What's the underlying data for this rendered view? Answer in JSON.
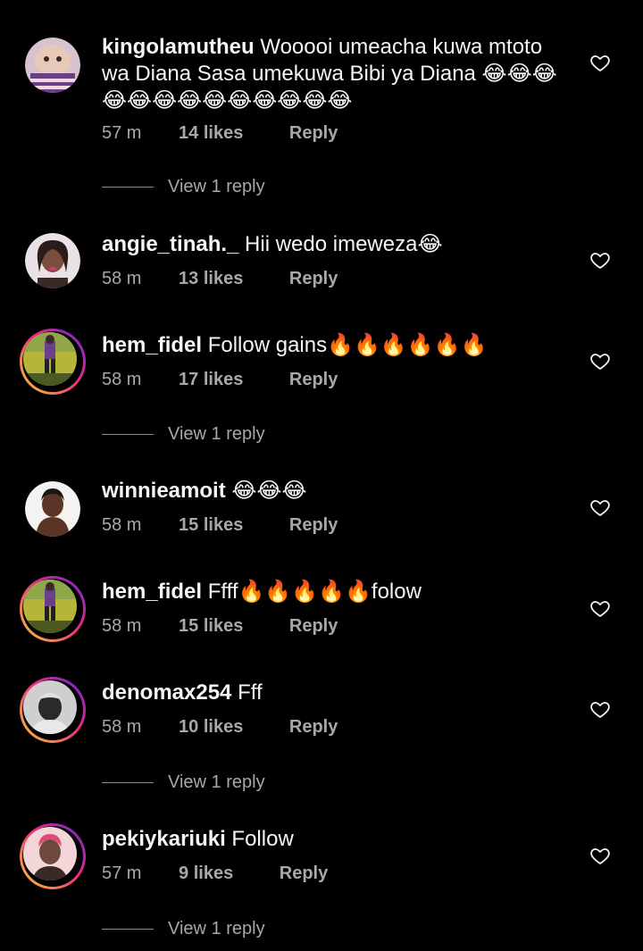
{
  "comments": [
    {
      "username": "kingolamutheu",
      "text": "Wooooi umeacha kuwa mtoto wa Diana Sasa umekuwa Bibi ya Diana 😂😂😂😂😂😂😂😂😂😂😂😂😂",
      "time": "57 m",
      "likes": "14 likes",
      "reply": "Reply",
      "view_replies": "View 1 reply",
      "story_ring": false,
      "avatar_colors": [
        "#c9a6b8",
        "#6b3f8a",
        "#f0d9e0"
      ]
    },
    {
      "username": "angie_tinah._",
      "text": "Hii wedo imeweza😂",
      "time": "58 m",
      "likes": "13 likes",
      "reply": "Reply",
      "view_replies": "",
      "story_ring": false,
      "avatar_colors": [
        "#e8e2e6",
        "#3a2a26",
        "#d63b70"
      ]
    },
    {
      "username": "hem_fidel",
      "text": "Follow gains🔥🔥🔥🔥🔥🔥",
      "time": "58 m",
      "likes": "17 likes",
      "reply": "Reply",
      "view_replies": "View 1 reply",
      "story_ring": true,
      "avatar_colors": [
        "#b7b43a",
        "#4a5a20",
        "#6a3f8a"
      ]
    },
    {
      "username": "winnieamoit",
      "text": "😂😂😂",
      "time": "58 m",
      "likes": "15 likes",
      "reply": "Reply",
      "view_replies": "",
      "story_ring": false,
      "avatar_colors": [
        "#f5f3f2",
        "#5a3526",
        "#c9a487"
      ]
    },
    {
      "username": "hem_fidel",
      "text": "Ffff🔥🔥🔥🔥🔥folow",
      "time": "58 m",
      "likes": "15 likes",
      "reply": "Reply",
      "view_replies": "",
      "story_ring": true,
      "avatar_colors": [
        "#b7b43a",
        "#4a5a20",
        "#6a3f8a"
      ]
    },
    {
      "username": "denomax254",
      "text": "Fff",
      "time": "58 m",
      "likes": "10 likes",
      "reply": "Reply",
      "view_replies": "View 1 reply",
      "story_ring": true,
      "avatar_colors": [
        "#bfbfbf",
        "#2a2a2a",
        "#e0e0e0"
      ]
    },
    {
      "username": "pekiykariuki",
      "text": "Follow",
      "time": "57 m",
      "likes": "9 likes",
      "reply": "Reply",
      "view_replies": "View 1 reply",
      "story_ring": true,
      "avatar_colors": [
        "#f2d6d8",
        "#e04a7a",
        "#3a2a26"
      ]
    }
  ],
  "icons": {
    "like": "heart-outline-icon"
  },
  "colors": {
    "background": "#000000",
    "text": "#f5f5f5",
    "secondary": "#a8a8a8"
  }
}
